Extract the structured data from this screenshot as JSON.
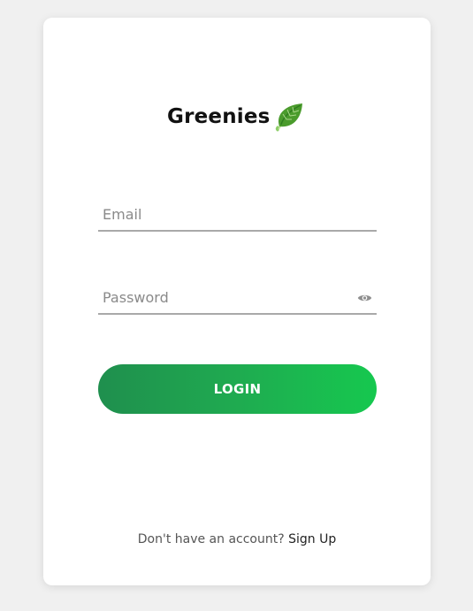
{
  "brand": {
    "name": "Greenies",
    "logo_icon": "leaf-icon",
    "leaf_colors": [
      "#5aa832",
      "#2f7d1f",
      "#c9e6a6"
    ]
  },
  "form": {
    "email_placeholder": "Email",
    "email_value": "",
    "password_placeholder": "Password",
    "password_value": "",
    "password_toggle_icon": "eye-icon",
    "login_label": "LOGIN"
  },
  "footer": {
    "prompt": "Don't have an account? ",
    "signup_label": "Sign Up"
  },
  "colors": {
    "background": "#f0f0f0",
    "card": "#ffffff",
    "button_gradient_start": "#1f8f4e",
    "button_gradient_end": "#16c84f",
    "underline": "#a9a9a9"
  }
}
